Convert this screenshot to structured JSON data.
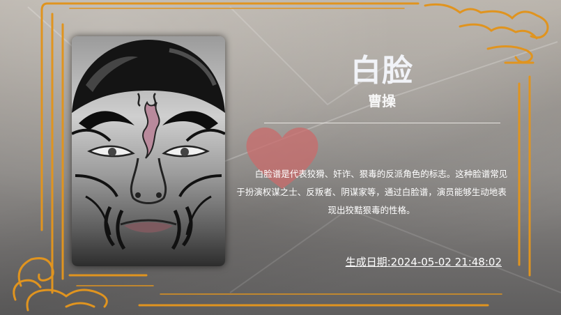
{
  "mask": {
    "name": "白脸",
    "character": "曹操",
    "description": "白脸谱是代表狡猾、奸诈、狠毒的反派角色的标志。这种脸谱常见于扮演权谋之士、反叛者、阴谋家等，通过白脸谱，演员能够生动地表现出狡黠狠毒的性格。"
  },
  "footer": {
    "date_text": "生成日期:2024-05-02 21:48:02"
  },
  "colors": {
    "frame_gold": "#e0941f",
    "heart": "#c96b6b"
  },
  "icons": [
    "face-mask-image",
    "heart-icon",
    "cloud-ornament-icon"
  ]
}
